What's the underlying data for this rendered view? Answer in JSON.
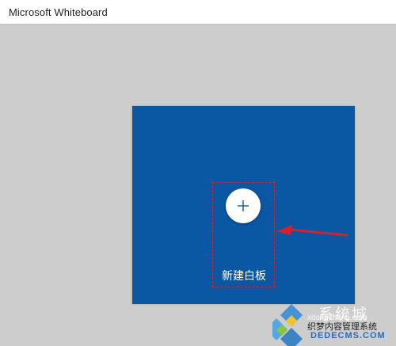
{
  "window": {
    "title": "Microsoft Whiteboard"
  },
  "new_board": {
    "label": "新建白板",
    "icon": "plus-icon",
    "tile_color": "#0a58a3"
  },
  "annotation": {
    "highlight_color": "#d9202a"
  },
  "watermark": {
    "brand": "系统城",
    "domain": "xitongcheng.com",
    "subtitle": "织梦内容管理系统",
    "url": "DEDECMS.COM"
  }
}
